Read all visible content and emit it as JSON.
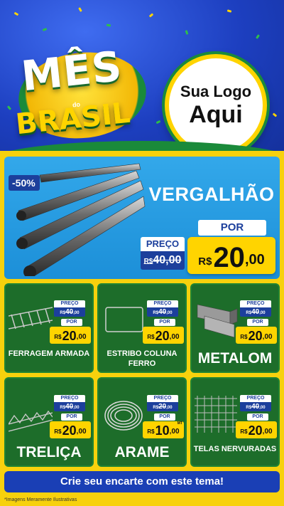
{
  "header": {
    "title_mes": "MÊS",
    "title_do": "do",
    "title_brasil": "BRASIL",
    "logo_line1": "Sua Logo",
    "logo_line2": "Aqui"
  },
  "hero": {
    "discount": "-50%",
    "name": "VERGALHÃO",
    "preco_label": "PREÇO",
    "old_currency": "R$",
    "old_price": "40,00",
    "por_label": "POR",
    "currency": "R$",
    "price_int": "20",
    "price_dec": ",00"
  },
  "products": [
    {
      "name": "FERRAGEM ARMADA",
      "preco_label": "PREÇO",
      "old_currency": "R$",
      "old_int": "40",
      "old_dec": ",00",
      "por_label": "POR",
      "currency": "R$",
      "price_int": "20",
      "price_dec": ",00",
      "unit": ""
    },
    {
      "name": "ESTRIBO COLUNA FERRO",
      "preco_label": "PREÇO",
      "old_currency": "R$",
      "old_int": "40",
      "old_dec": ",00",
      "por_label": "POR",
      "currency": "R$",
      "price_int": "20",
      "price_dec": ",00",
      "unit": ""
    },
    {
      "name": "METALOM",
      "preco_label": "PREÇO",
      "old_currency": "R$",
      "old_int": "40",
      "old_dec": ",00",
      "por_label": "POR",
      "currency": "R$",
      "price_int": "20",
      "price_dec": ",00",
      "unit": ""
    },
    {
      "name": "TRELIÇA",
      "preco_label": "PREÇO",
      "old_currency": "R$",
      "old_int": "40",
      "old_dec": ",00",
      "por_label": "POR",
      "currency": "R$",
      "price_int": "20",
      "price_dec": ",00",
      "unit": ""
    },
    {
      "name": "ARAME",
      "preco_label": "PREÇO",
      "old_currency": "R$",
      "old_int": "20",
      "old_dec": ",00",
      "por_label": "POR",
      "currency": "R$",
      "price_int": "10",
      "price_dec": ",00",
      "unit": "MT"
    },
    {
      "name": "TELAS NERVURADAS",
      "preco_label": "PREÇO",
      "old_currency": "R$",
      "old_int": "40",
      "old_dec": ",00",
      "por_label": "POR",
      "currency": "R$",
      "price_int": "20",
      "price_dec": ",00",
      "unit": ""
    }
  ],
  "cta": {
    "label": "Crie seu encarte com este tema!"
  },
  "footnote": "*Imagens Meramente Ilustrativas",
  "colors": {
    "blue": "#1a3fb5",
    "green": "#1d6d2a",
    "yellow": "#ffd400",
    "sky": "#33a8ea"
  }
}
